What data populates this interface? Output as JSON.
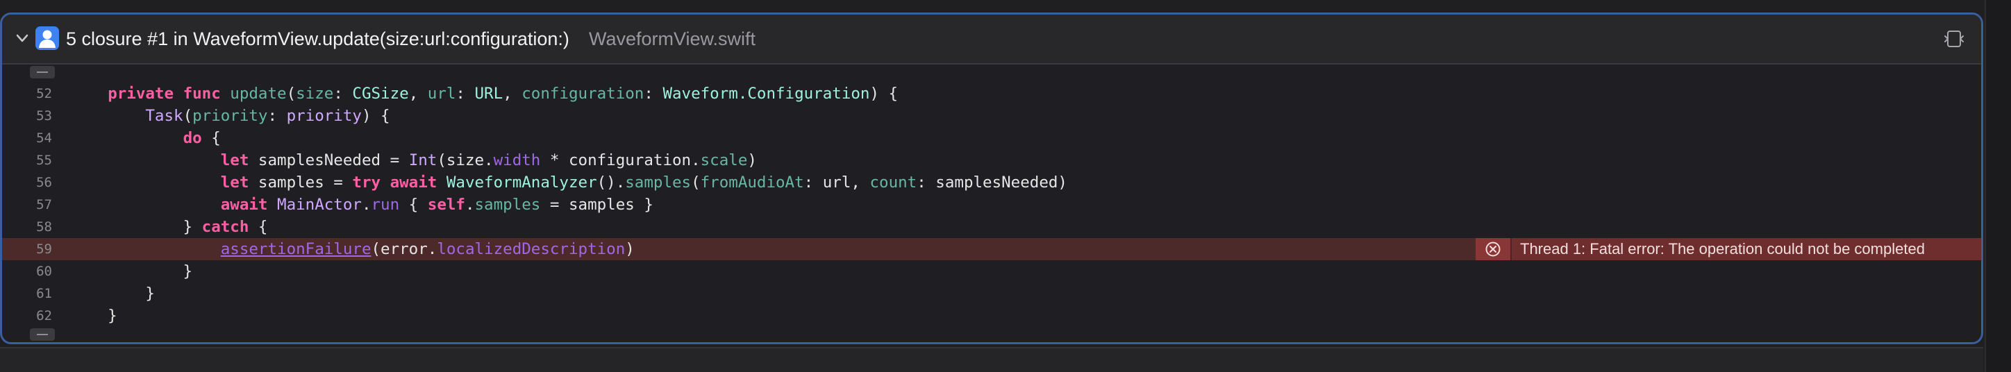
{
  "header": {
    "title": "5 closure #1 in WaveformView.update(size:url:configuration:)",
    "file": "WaveformView.swift"
  },
  "icons": {
    "chevron": "chevron-down-icon",
    "avatar": "person-avatar-icon",
    "expand": "expand-window-icon",
    "error": "error-x-circle-icon"
  },
  "colors": {
    "border": "#3a5f9e",
    "keyword": "#fc5fa3",
    "type": "#d0a8ff",
    "identifier": "#67b7a4",
    "function": "#a167e6",
    "error_bg": "#4c2a2a"
  },
  "code": {
    "lines": [
      {
        "n": "52",
        "tokens": [
          [
            "pl",
            "    "
          ],
          [
            "kw",
            "private"
          ],
          [
            "pl",
            " "
          ],
          [
            "kw",
            "func"
          ],
          [
            "pl",
            " "
          ],
          [
            "id",
            "update"
          ],
          [
            "pl",
            "("
          ],
          [
            "id",
            "size"
          ],
          [
            "pl",
            ": "
          ],
          [
            "tyd",
            "CGSize"
          ],
          [
            "pl",
            ", "
          ],
          [
            "id",
            "url"
          ],
          [
            "pl",
            ": "
          ],
          [
            "tyd",
            "URL"
          ],
          [
            "pl",
            ", "
          ],
          [
            "id",
            "configuration"
          ],
          [
            "pl",
            ": "
          ],
          [
            "tyd",
            "Waveform.Configuration"
          ],
          [
            "pl",
            ") {"
          ]
        ]
      },
      {
        "n": "53",
        "tokens": [
          [
            "pl",
            "        "
          ],
          [
            "ty",
            "Task"
          ],
          [
            "pl",
            "("
          ],
          [
            "id",
            "priority"
          ],
          [
            "pl",
            ": "
          ],
          [
            "ty",
            "priority"
          ],
          [
            "pl",
            ") {"
          ]
        ]
      },
      {
        "n": "54",
        "tokens": [
          [
            "pl",
            "            "
          ],
          [
            "kw",
            "do"
          ],
          [
            "pl",
            " {"
          ]
        ]
      },
      {
        "n": "55",
        "tokens": [
          [
            "pl",
            "                "
          ],
          [
            "kw",
            "let"
          ],
          [
            "pl",
            " samplesNeeded = "
          ],
          [
            "ty",
            "Int"
          ],
          [
            "pl",
            "(size."
          ],
          [
            "fn",
            "width"
          ],
          [
            "pl",
            " * configuration."
          ],
          [
            "id",
            "scale"
          ],
          [
            "pl",
            ")"
          ]
        ]
      },
      {
        "n": "56",
        "tokens": [
          [
            "pl",
            "                "
          ],
          [
            "kw",
            "let"
          ],
          [
            "pl",
            " samples = "
          ],
          [
            "kw",
            "try"
          ],
          [
            "pl",
            " "
          ],
          [
            "kw",
            "await"
          ],
          [
            "pl",
            " "
          ],
          [
            "tyd",
            "WaveformAnalyzer"
          ],
          [
            "pl",
            "()."
          ],
          [
            "id",
            "samples"
          ],
          [
            "pl",
            "("
          ],
          [
            "id",
            "fromAudioAt"
          ],
          [
            "pl",
            ": url, "
          ],
          [
            "id",
            "count"
          ],
          [
            "pl",
            ": samplesNeeded)"
          ]
        ]
      },
      {
        "n": "57",
        "tokens": [
          [
            "pl",
            "                "
          ],
          [
            "kw",
            "await"
          ],
          [
            "pl",
            " "
          ],
          [
            "ty",
            "MainActor"
          ],
          [
            "pl",
            "."
          ],
          [
            "fn",
            "run"
          ],
          [
            "pl",
            " { "
          ],
          [
            "kw",
            "self"
          ],
          [
            "pl",
            "."
          ],
          [
            "id",
            "samples"
          ],
          [
            "pl",
            " = samples }"
          ]
        ]
      },
      {
        "n": "58",
        "tokens": [
          [
            "pl",
            "            } "
          ],
          [
            "kw",
            "catch"
          ],
          [
            "pl",
            " {"
          ]
        ]
      },
      {
        "n": "59",
        "error": true,
        "tokens": [
          [
            "pl",
            "                "
          ],
          [
            "fn ul",
            "assertionFailure"
          ],
          [
            "pl",
            "(error."
          ],
          [
            "fn",
            "localizedDescription"
          ],
          [
            "pl",
            ")"
          ]
        ]
      },
      {
        "n": "60",
        "tokens": [
          [
            "pl",
            "            }"
          ]
        ]
      },
      {
        "n": "61",
        "tokens": [
          [
            "pl",
            "        }"
          ]
        ]
      },
      {
        "n": "62",
        "tokens": [
          [
            "pl",
            "    }"
          ]
        ]
      }
    ]
  },
  "error": {
    "message": "Thread 1: Fatal error: The operation could not be completed"
  }
}
